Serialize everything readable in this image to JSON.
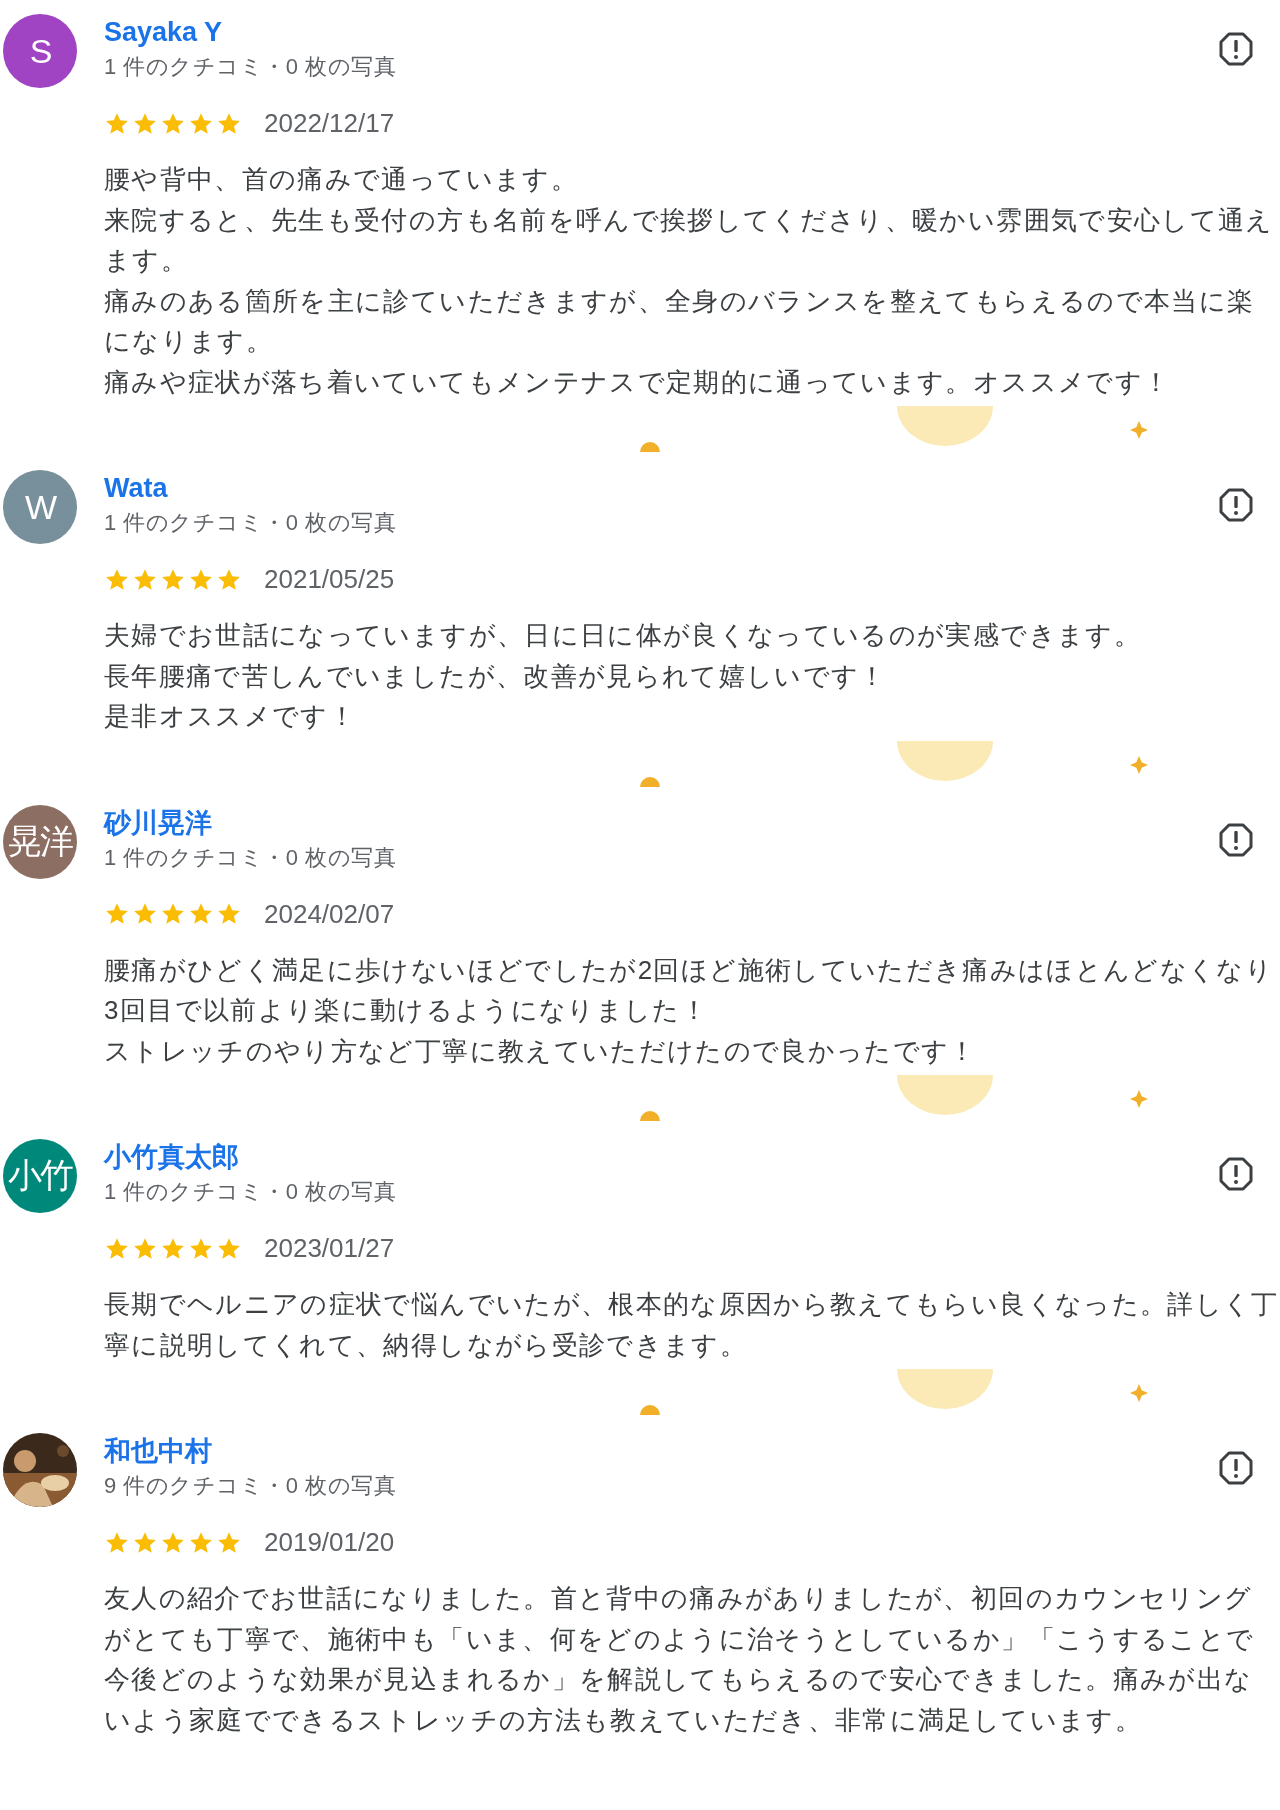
{
  "reviews": [
    {
      "avatar": {
        "kind": "letter",
        "text": "S",
        "color": "#a144c4"
      },
      "name": "Sayaka Y",
      "meta": "1 件のクチコミ・0 枚の写真",
      "stars": 5,
      "date": "2022/12/17",
      "paragraphs": [
        "腰や背中、首の痛みで通っています。",
        "来院すると、先生も受付の方も名前を呼んで挨拶してくださり、暖かい雰囲気で安心して通えます。",
        "痛みのある箇所を主に診ていただきますが、全身のバランスを整えてもらえるので本当に楽になります。",
        "痛みや症状が落ち着いていてもメンテナスで定期的に通っています。オススメです！"
      ]
    },
    {
      "avatar": {
        "kind": "letter",
        "text": "W",
        "color": "#78909c"
      },
      "name": "Wata",
      "meta": "1 件のクチコミ・0 枚の写真",
      "stars": 5,
      "date": "2021/05/25",
      "paragraphs": [
        "夫婦でお世話になっていますが、日に日に体が良くなっているのが実感できます。",
        "長年腰痛で苦しんでいましたが、改善が見られて嬉しいです！",
        "是非オススメです！"
      ]
    },
    {
      "avatar": {
        "kind": "letter",
        "text": "晃洋",
        "color": "#8d6e63"
      },
      "name": "砂川晃洋",
      "meta": "1 件のクチコミ・0 枚の写真",
      "stars": 5,
      "date": "2024/02/07",
      "paragraphs": [
        "腰痛がひどく満足に歩けないほどでしたが2回ほど施術していただき痛みはほとんどなくなり3回目で以前より楽に動けるようになりました！",
        "ストレッチのやり方など丁寧に教えていただけたので良かったです！"
      ]
    },
    {
      "avatar": {
        "kind": "letter",
        "text": "小竹",
        "color": "#00897b"
      },
      "name": "小竹真太郎",
      "meta": "1 件のクチコミ・0 枚の写真",
      "stars": 5,
      "date": "2023/01/27",
      "paragraphs": [
        "長期でヘルニアの症状で悩んでいたが、根本的な原因から教えてもらい良くなった。詳しく丁寧に説明してくれて、納得しながら受診できます。"
      ]
    },
    {
      "avatar": {
        "kind": "picture"
      },
      "name": "和也中村",
      "meta": "9 件のクチコミ・0 枚の写真",
      "stars": 5,
      "date": "2019/01/20",
      "paragraphs": [
        "友人の紹介でお世話になりました。首と背中の痛みがありましたが、初回のカウンセリングがとても丁寧で、施術中も「いま、何をどのように治そうとしているか」「こうすることで今後どのような効果が見込まれるか」を解説してもらえるので安心できました。痛みが出ないよう家庭でできるストレッチの方法も教えていただき、非常に満足しています。"
      ]
    }
  ]
}
